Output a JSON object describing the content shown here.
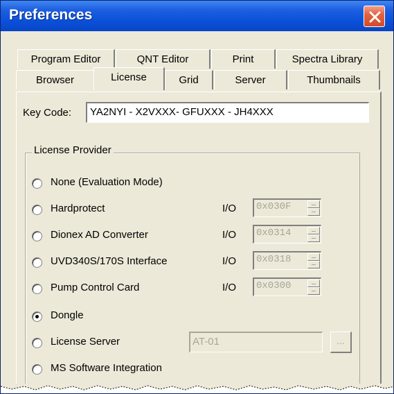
{
  "window": {
    "title": "Preferences"
  },
  "tabs": {
    "row1": [
      "Program Editor",
      "QNT Editor",
      "Print",
      "Spectra Library"
    ],
    "row2": [
      "Browser",
      "License",
      "Grid",
      "Server",
      "Thumbnails"
    ],
    "active": "License"
  },
  "license": {
    "key_code_label": "Key Code:",
    "key_code_value": "YA2NYI - X2VXXX- GFUXXX - JH4XXX",
    "group_title": "License Provider",
    "io_label": "I/O",
    "options": [
      {
        "label": "None (Evaluation Mode)",
        "checked": false
      },
      {
        "label": "Hardprotect",
        "checked": false,
        "io": "0x030F"
      },
      {
        "label": "Dionex AD Converter",
        "checked": false,
        "io": "0x0314"
      },
      {
        "label": "UVD340S/170S Interface",
        "checked": false,
        "io": "0x0318"
      },
      {
        "label": "Pump Control Card",
        "checked": false,
        "io": "0x0300"
      },
      {
        "label": "Dongle",
        "checked": true
      },
      {
        "label": "License Server",
        "checked": false,
        "server": "AT-01",
        "browse": "..."
      },
      {
        "label": "MS Software Integration",
        "checked": false
      }
    ]
  },
  "icons": {
    "close": "close-icon",
    "radio": "radio-button"
  }
}
